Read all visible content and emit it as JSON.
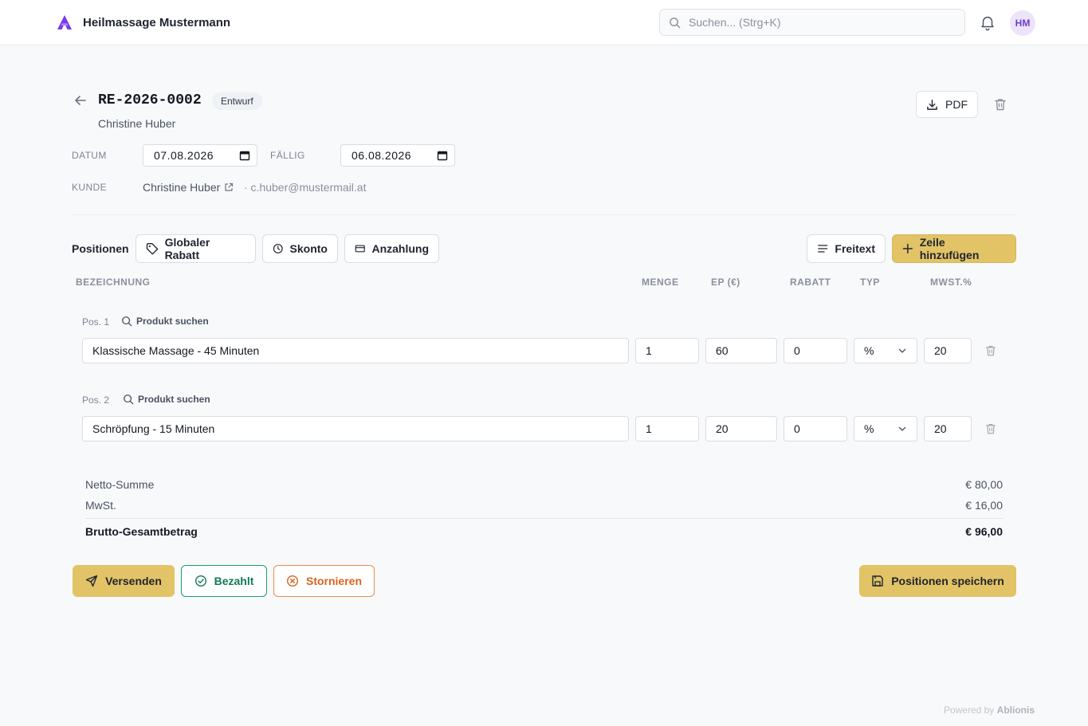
{
  "header": {
    "brand_name": "Heilmassage Mustermann",
    "search_placeholder": "Suchen... (Strg+K)",
    "avatar_initials": "HM",
    "accent_color": "#7c3aed"
  },
  "invoice": {
    "number": "RE-2026-0002",
    "status": "Entwurf",
    "customer_name": "Christine Huber",
    "pdf_label": "PDF",
    "date_label": "DATUM",
    "date_value": "07.08.2026",
    "due_label": "FÄLLIG",
    "due_value": "06.08.2026",
    "customer_label": "KUNDE",
    "customer_link": "Christine Huber",
    "customer_email": "· c.huber@mustermail.at"
  },
  "toolbar": {
    "title": "Positionen",
    "global_discount_label": "Globaler Rabatt",
    "skonto_label": "Skonto",
    "deposit_label": "Anzahlung",
    "freetext_label": "Freitext",
    "add_row_label": "Zeile hinzufügen"
  },
  "columns": {
    "description": "BEZEICHNUNG",
    "quantity": "MENGE",
    "unit_price": "EP (€)",
    "discount": "RABATT",
    "type": "TYP",
    "vat": "MWST.%"
  },
  "positions": [
    {
      "label": "Pos. 1",
      "search_label": "Produkt suchen",
      "description": "Klassische Massage - 45 Minuten",
      "quantity": "1",
      "unit_price": "60",
      "discount": "0",
      "type": "%",
      "vat": "20"
    },
    {
      "label": "Pos. 2",
      "search_label": "Produkt suchen",
      "description": "Schröpfung - 15 Minuten",
      "quantity": "1",
      "unit_price": "20",
      "discount": "0",
      "type": "%",
      "vat": "20"
    }
  ],
  "totals": {
    "net_label": "Netto-Summe",
    "net_value": "€ 80,00",
    "vat_label": "MwSt.",
    "vat_value": "€ 16,00",
    "gross_label": "Brutto-Gesamtbetrag",
    "gross_value": "€ 96,00"
  },
  "actions": {
    "send_label": "Versenden",
    "paid_label": "Bezahlt",
    "cancel_label": "Stornieren",
    "save_label": "Positionen speichern",
    "send_color": "#e2c366",
    "paid_color": "#1d9a6c",
    "cancel_color": "#ee8a4b"
  },
  "footer": {
    "powered_prefix": "Powered by",
    "powered_brand": "Ablionis"
  }
}
